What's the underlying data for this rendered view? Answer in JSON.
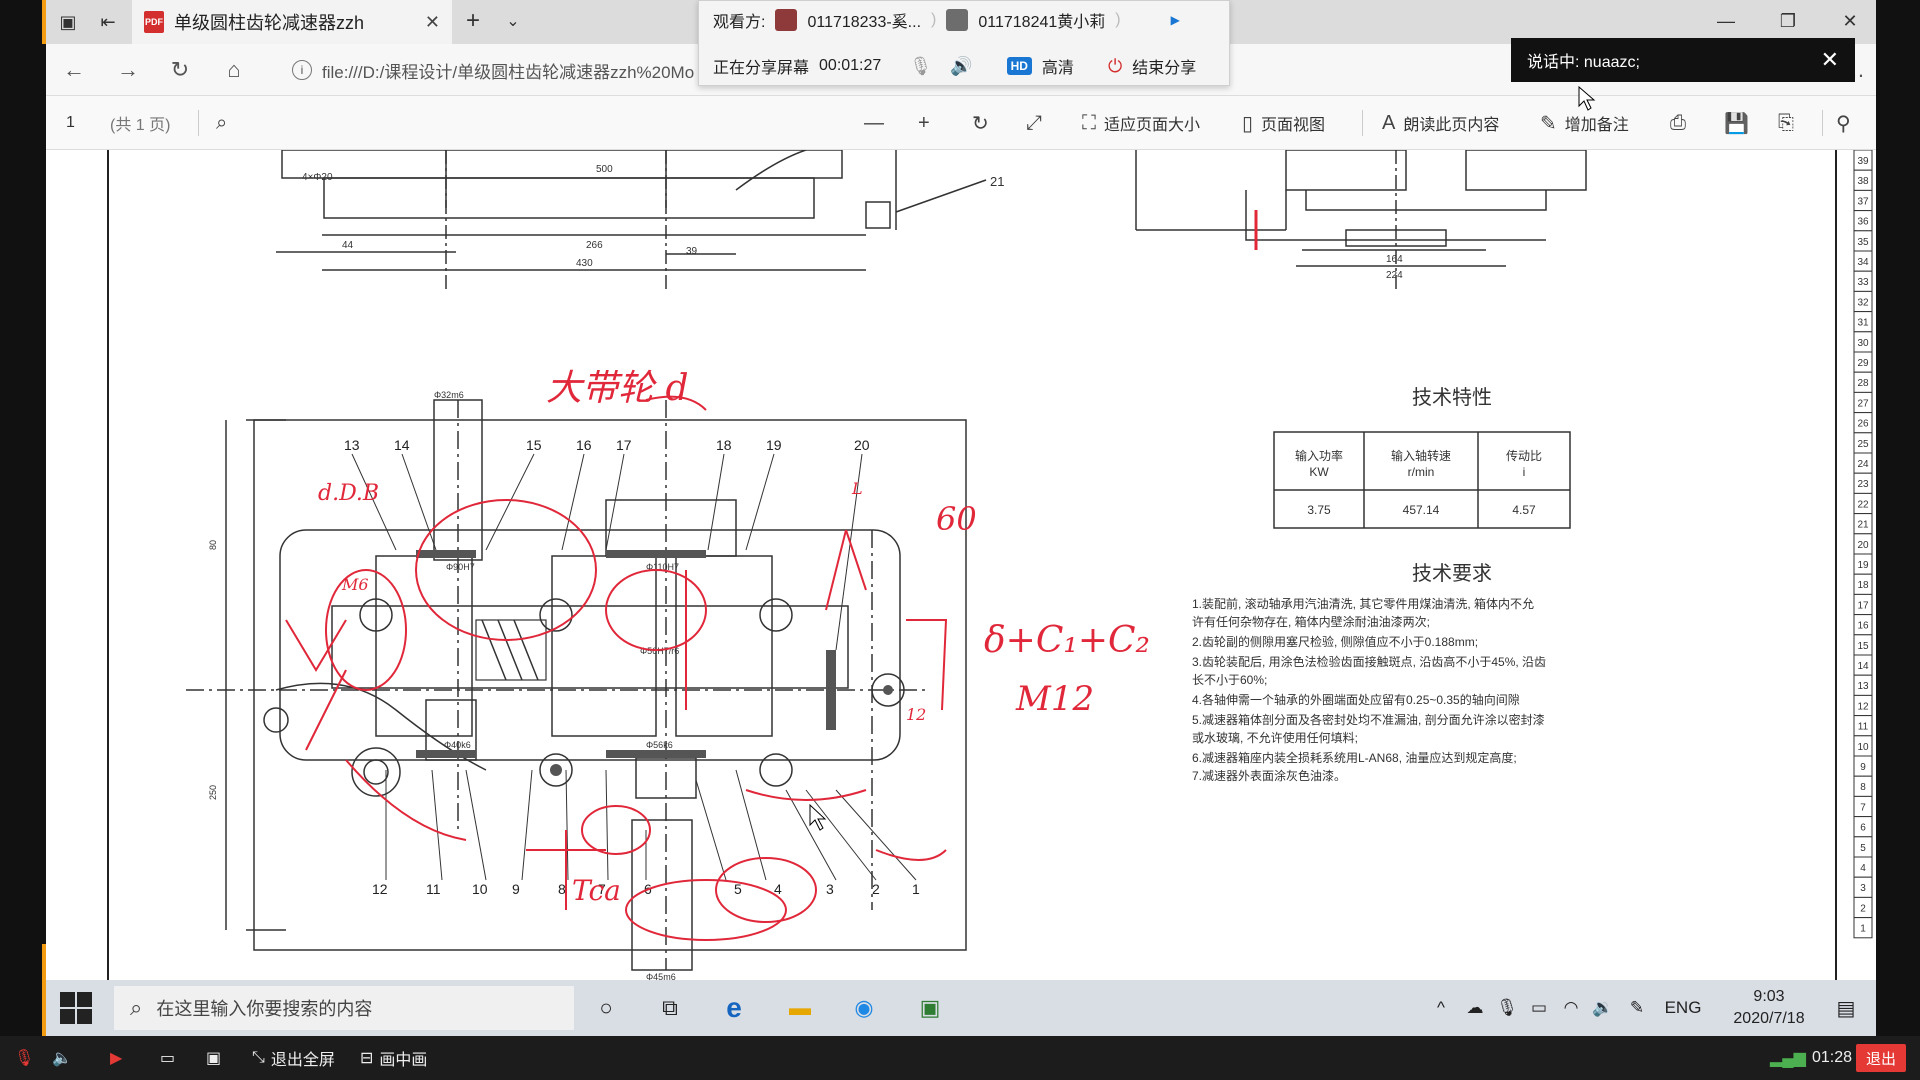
{
  "browser": {
    "tab_title": "单级圆柱齿轮减速器zzh",
    "address": "file:///D:/课程设计/单级圆柱齿轮减速器zzh%20Mo"
  },
  "share_panel": {
    "viewer_label": "观看方:",
    "viewer_1": "011718233-奚...",
    "viewer_2": "011718241黄小莉",
    "sharing_label": "正在分享屏幕",
    "timer": "00:01:27",
    "hd_badge": "HD",
    "quality": "高清",
    "end_share": "结束分享"
  },
  "speaking": {
    "text": "说话中: nuaazc;"
  },
  "pdf_toolbar": {
    "page_number": "1",
    "page_count": "(共 1 页)",
    "fit_page": "适应页面大小",
    "page_view": "页面视图",
    "read_aloud": "朗读此页内容",
    "add_note": "增加备注"
  },
  "drawing": {
    "tech_char_title": "技术特性",
    "table_headers": [
      "输入功率\nKW",
      "输入轴转速\nr/min",
      "传动比\ni"
    ],
    "table_values": [
      "3.75",
      "457.14",
      "4.57"
    ],
    "tech_req_title": "技术要求",
    "requirements": [
      "1.装配前, 滚动轴承用汽油清洗, 其它零件用煤油清洗, 箱体内不允",
      "  许有任何杂物存在, 箱体内壁涂耐油油漆两次;",
      "2.齿轮副的侧隙用塞尺检验, 侧隙值应不小于0.188mm;",
      "3.齿轮装配后, 用涂色法检验齿面接触斑点, 沿齿高不小于45%, 沿齿",
      "  长不小于60%;",
      "4.各轴伸需一个轴承的外圈端面处应留有0.25~0.35的轴向间隙",
      "5.减速器箱体剖分面及各密封处均不准漏油, 剖分面允许涂以密封漆",
      "  或水玻璃, 不允许使用任何填料;",
      "6.减速器箱座内装全损耗系统用L-AN68, 油量应达到规定高度;",
      "7.减速器外表面涂灰色油漆。"
    ],
    "top_dims": [
      "500",
      "266",
      "430",
      "39",
      "44",
      "4×Φ20"
    ],
    "right_dims": [
      "164",
      "224"
    ],
    "part_numbers_top": [
      "13",
      "14",
      "15",
      "16",
      "17",
      "18",
      "19",
      "20",
      "21"
    ],
    "part_numbers_bottom": [
      "12",
      "11",
      "10",
      "9",
      "8",
      "7",
      "6",
      "5",
      "4",
      "3",
      "2",
      "1"
    ],
    "side_dims": [
      "80",
      "250"
    ],
    "inner_labels": [
      "Φ110H7",
      "Φ90H7",
      "Φ40k6",
      "Φ56k6",
      "Φ56H7/r6",
      "Φ32m6",
      "Φ45m6"
    ],
    "annotations": {
      "big_gear": "大带轮 d",
      "formula": "δ+C₁+C₂",
      "m12": "M12",
      "dim_60": "60",
      "ddb": "d.D.B",
      "m6": "M6",
      "tca": "Tca",
      "small_num": "12",
      "l_label": "L"
    },
    "ruler_numbers": [
      "39",
      "38",
      "37",
      "36",
      "35",
      "34",
      "33",
      "32",
      "31",
      "30",
      "29",
      "28",
      "27",
      "26",
      "25",
      "24",
      "23",
      "22",
      "21",
      "20",
      "19",
      "18",
      "17",
      "16",
      "15",
      "14",
      "13",
      "12",
      "11",
      "10",
      "9",
      "8",
      "7",
      "6",
      "5",
      "4",
      "3",
      "2",
      "1"
    ]
  },
  "taskbar": {
    "search_placeholder": "在这里输入你要搜索的内容",
    "lang": "ENG",
    "time": "9:03",
    "date": "2020/7/18"
  },
  "meeting_bar": {
    "exit_fullscreen": "退出全屏",
    "pip": "画中画",
    "elapsed": "01:28",
    "exit": "退出"
  },
  "colors": {
    "annotation_red": "#e0283a",
    "accent_orange": "#f39c12",
    "exit_red": "#e53935",
    "hd_blue": "#1976d2"
  }
}
